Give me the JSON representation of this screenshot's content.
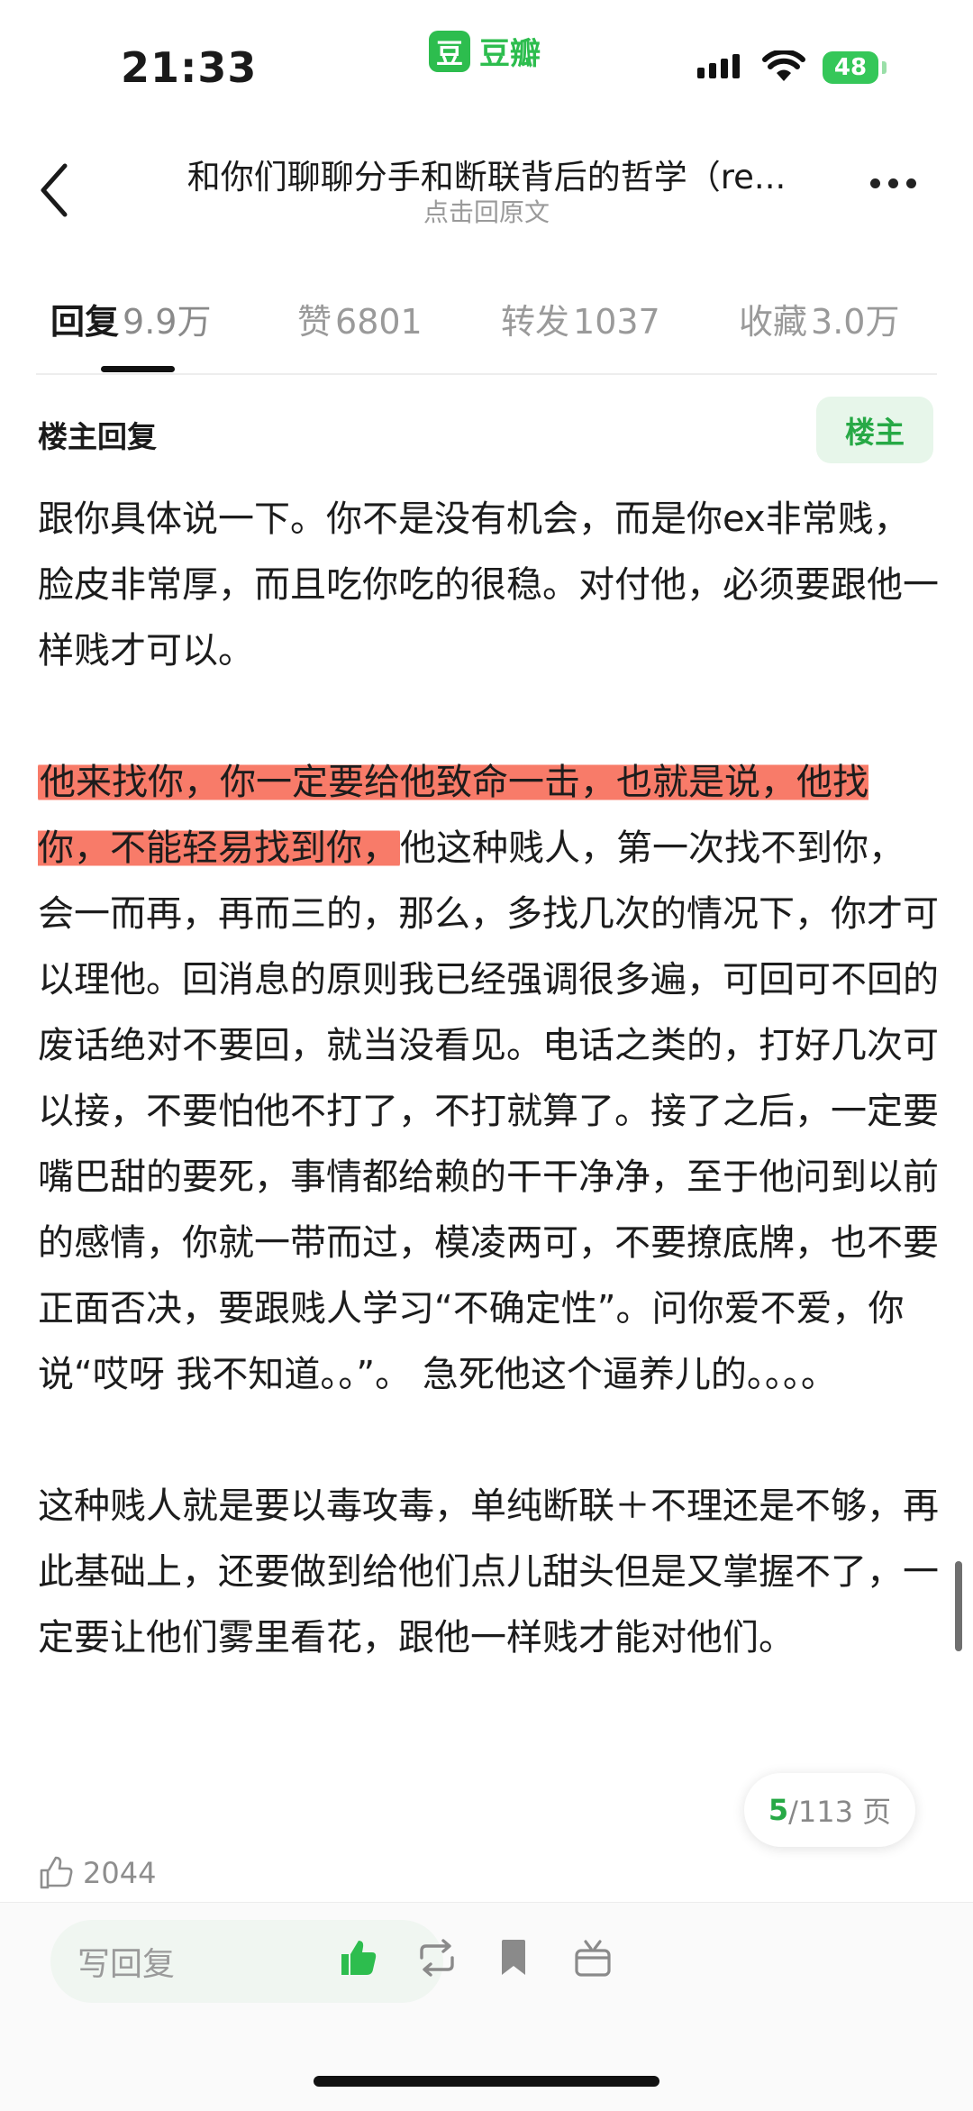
{
  "status_bar": {
    "time": "21:33",
    "app_name": "豆瓣",
    "app_logo_char": "豆",
    "battery": "48"
  },
  "header": {
    "title": "和你们聊聊分手和断联背后的哲学（re...",
    "subtitle": "点击回原文",
    "back_icon": "chevron-left-icon",
    "more_icon": "more-dots-icon"
  },
  "tabs": [
    {
      "label": "回复",
      "count": "9.9万",
      "active": true
    },
    {
      "label": "赞",
      "count": "6801",
      "active": false
    },
    {
      "label": "转发",
      "count": "1037",
      "active": false
    },
    {
      "label": "收藏",
      "count": "3.0万",
      "active": false
    }
  ],
  "reply": {
    "header": "楼主回复",
    "badge": "楼主",
    "para1": "跟你具体说一下。你不是没有机会，而是你ex非常贱，脸皮非常厚，而且吃你吃的很稳。对付他，必须要跟他一样贱才可以。",
    "para2_highlight": "他来找你，你一定要给他致命一击，也就是说，他找你，不能轻易找到你，",
    "para2_rest": "他这种贱人，第一次找不到你，会一而再，再而三的，那么，多找几次的情况下，你才可以理他。回消息的原则我已经强调很多遍，可回可不回的废话绝对不要回，就当没看见。电话之类的，打好几次可以接，不要怕他不打了，不打就算了。接了之后，一定要嘴巴甜的要死，事情都给赖的干干净净，至于他问到以前的感情，你就一带而过，模凌两可，不要撩底牌，也不要正面否决，要跟贱人学习“不确定性”。问你爱不爱，你说“哎呀 我不知道。。”。 急死他这个逼养儿的。。。。",
    "para3": "这种贱人就是要以毒攻毒，单纯断联＋不理还是不够，再此基础上，还要做到给他们点儿甜头但是又掌握不了，一定要让他们雾里看花，跟他一样贱才能对他们。",
    "likes": "2044"
  },
  "pagination": {
    "current": "5",
    "total": "/113 页"
  },
  "bottom_bar": {
    "reply_placeholder": "写回复",
    "icons": [
      "thumbs-up-icon",
      "repost-icon",
      "bookmark-icon",
      "gift-icon"
    ],
    "accent_color": "#2dbd4e"
  }
}
